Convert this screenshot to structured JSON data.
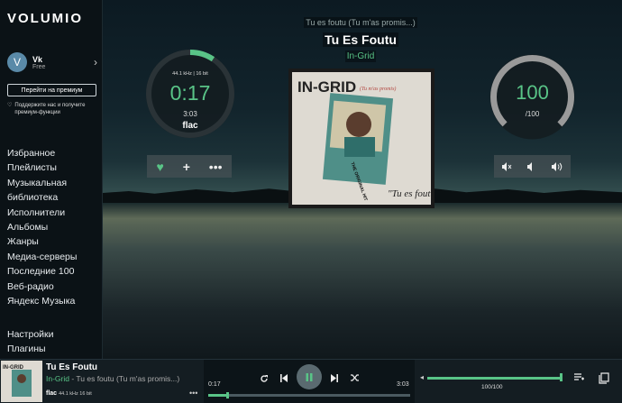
{
  "app": {
    "logo": "VOLUMIO"
  },
  "user": {
    "initial": "V",
    "name": "Vk",
    "plan": "Free"
  },
  "premium": {
    "button": "Перейти на премиум",
    "support_text": "Поддержите нас и получите премиум-функции"
  },
  "nav": {
    "items": [
      "Избранное",
      "Плейлисты",
      "Музыкальная",
      "библиотека",
      "Исполнители",
      "Альбомы",
      "Жанры",
      "Медиа-серверы",
      "Последние 100",
      "Веб-радио",
      "Яндекс Музыка"
    ],
    "bottom_items": [
      "Настройки",
      "Плагины"
    ]
  },
  "now_playing": {
    "subtitle": "Tu es foutu (Tu m'as promis...)",
    "title": "Tu Es Foutu",
    "artist": "In-Grid",
    "quality": "44.1 kHz | 16 bit",
    "elapsed": "0:17",
    "duration": "3:03",
    "format": "flac",
    "progress": 0.093
  },
  "album_art": {
    "brand": "IN-GRID",
    "subtitle": "(Tu m'as promis)",
    "caption": "\"Tu es foutu\"",
    "sticker": "THE ORIGINAL HIT"
  },
  "volume": {
    "value": "100",
    "max": "/100",
    "fraction": 1.0,
    "text": "100/100"
  },
  "bottom": {
    "title": "Tu Es Foutu",
    "artist": "In-Grid",
    "separator": " - ",
    "track": "Tu es foutu (Tu m'as promis...)",
    "format": "flac",
    "quality": "44.1 kHz 16 bit",
    "elapsed": "0:17",
    "duration": "3:03"
  },
  "colors": {
    "accent": "#59c487",
    "ring_track": "#2a3337",
    "volume_ring": "#9a9a9a"
  },
  "icons": {
    "heart": "heart-icon",
    "add": "plus-icon",
    "more": "ellipsis-icon",
    "vol_mute": "volume-mute-icon",
    "vol_down": "volume-down-icon",
    "vol_up": "volume-up-icon",
    "repeat": "repeat-icon",
    "prev": "skip-previous-icon",
    "pause": "pause-icon",
    "next": "skip-next-icon",
    "shuffle": "shuffle-icon",
    "queue": "queue-icon",
    "browse": "library-icon"
  }
}
